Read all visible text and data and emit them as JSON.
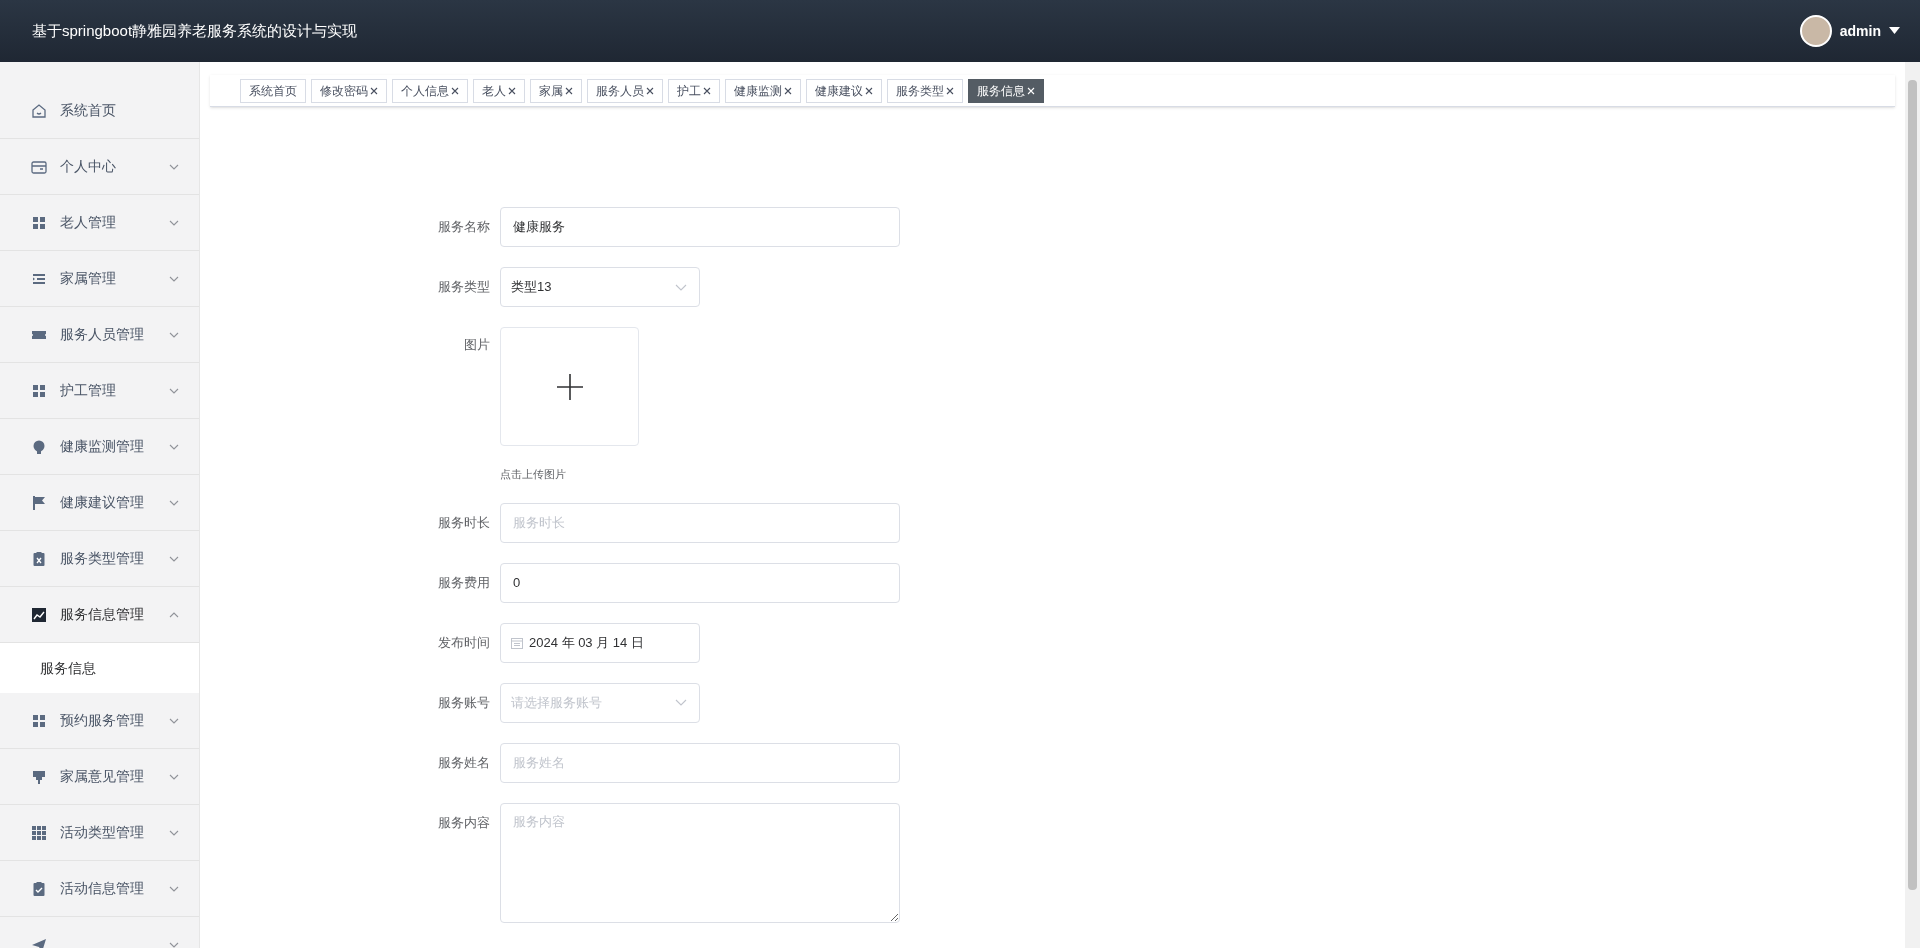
{
  "header": {
    "title": "基于springboot静雅园养老服务系统的设计与实现",
    "user": "admin"
  },
  "sidebar": {
    "items": [
      {
        "label": "系统首页",
        "kind": "link"
      },
      {
        "label": "个人中心",
        "kind": "submenu",
        "expanded": false
      },
      {
        "label": "老人管理",
        "kind": "submenu",
        "expanded": false
      },
      {
        "label": "家属管理",
        "kind": "submenu",
        "expanded": false
      },
      {
        "label": "服务人员管理",
        "kind": "submenu",
        "expanded": false
      },
      {
        "label": "护工管理",
        "kind": "submenu",
        "expanded": false
      },
      {
        "label": "健康监测管理",
        "kind": "submenu",
        "expanded": false
      },
      {
        "label": "健康建议管理",
        "kind": "submenu",
        "expanded": false
      },
      {
        "label": "服务类型管理",
        "kind": "submenu",
        "expanded": false
      },
      {
        "label": "服务信息管理",
        "kind": "submenu",
        "expanded": true,
        "children": [
          {
            "label": "服务信息",
            "selected": true
          }
        ]
      },
      {
        "label": "预约服务管理",
        "kind": "submenu",
        "expanded": false
      },
      {
        "label": "家属意见管理",
        "kind": "submenu",
        "expanded": false
      },
      {
        "label": "活动类型管理",
        "kind": "submenu",
        "expanded": false
      },
      {
        "label": "活动信息管理",
        "kind": "submenu",
        "expanded": false
      },
      {
        "kind": "submenu",
        "expanded": false
      }
    ]
  },
  "tabs": [
    {
      "label": "系统首页",
      "closable": false,
      "selected": false
    },
    {
      "label": "修改密码",
      "closable": true,
      "selected": false
    },
    {
      "label": "个人信息",
      "closable": true,
      "selected": false
    },
    {
      "label": "老人",
      "closable": true,
      "selected": false
    },
    {
      "label": "家属",
      "closable": true,
      "selected": false
    },
    {
      "label": "服务人员",
      "closable": true,
      "selected": false
    },
    {
      "label": "护工",
      "closable": true,
      "selected": false
    },
    {
      "label": "健康监测",
      "closable": true,
      "selected": false
    },
    {
      "label": "健康建议",
      "closable": true,
      "selected": false
    },
    {
      "label": "服务类型",
      "closable": true,
      "selected": false
    },
    {
      "label": "服务信息",
      "closable": true,
      "selected": true
    }
  ],
  "form": {
    "fields": [
      {
        "label": "服务名称",
        "kind": "text",
        "value": "健康服务"
      },
      {
        "label": "服务类型",
        "kind": "select",
        "value": "类型13"
      },
      {
        "label": "图片",
        "kind": "upload",
        "hint": "点击上传图片"
      },
      {
        "label": "服务时长",
        "kind": "text",
        "placeholder": "服务时长"
      },
      {
        "label": "服务费用",
        "kind": "text",
        "value": "0"
      },
      {
        "label": "发布时间",
        "kind": "date",
        "value": "2024 年 03 月 14 日"
      },
      {
        "label": "服务账号",
        "kind": "select",
        "placeholder": "请选择服务账号"
      },
      {
        "label": "服务姓名",
        "kind": "text",
        "placeholder": "服务姓名"
      },
      {
        "label": "服务内容",
        "kind": "textarea",
        "placeholder": "服务内容"
      }
    ]
  }
}
